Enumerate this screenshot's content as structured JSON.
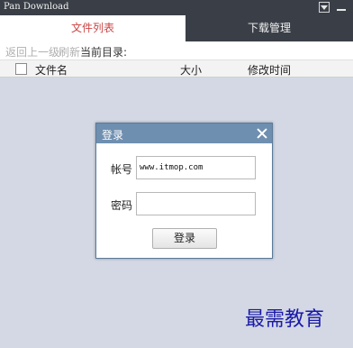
{
  "window": {
    "title": "Pan Download"
  },
  "tabs": [
    {
      "label": "文件列表",
      "active": true
    },
    {
      "label": "下载管理",
      "active": false
    }
  ],
  "toolbar": {
    "back_label": "返回上一级",
    "refresh_label": "刷新",
    "current_dir_label": "当前目录:"
  },
  "file_list": {
    "columns": [
      "文件名",
      "大小",
      "修改时间"
    ],
    "rows": []
  },
  "login_dialog": {
    "title": "登录",
    "account_label": "帐号",
    "account_value": "www.itmop.com",
    "password_label": "密码",
    "password_value": "",
    "login_button": "登录"
  },
  "watermark": "最需教育",
  "colors": {
    "titlebar": "#3a3f47",
    "active_tab_text": "#cc4444",
    "list_background": "#d3d8e4",
    "dialog_header": "#6f8fb0",
    "watermark": "#1a1aa8"
  }
}
